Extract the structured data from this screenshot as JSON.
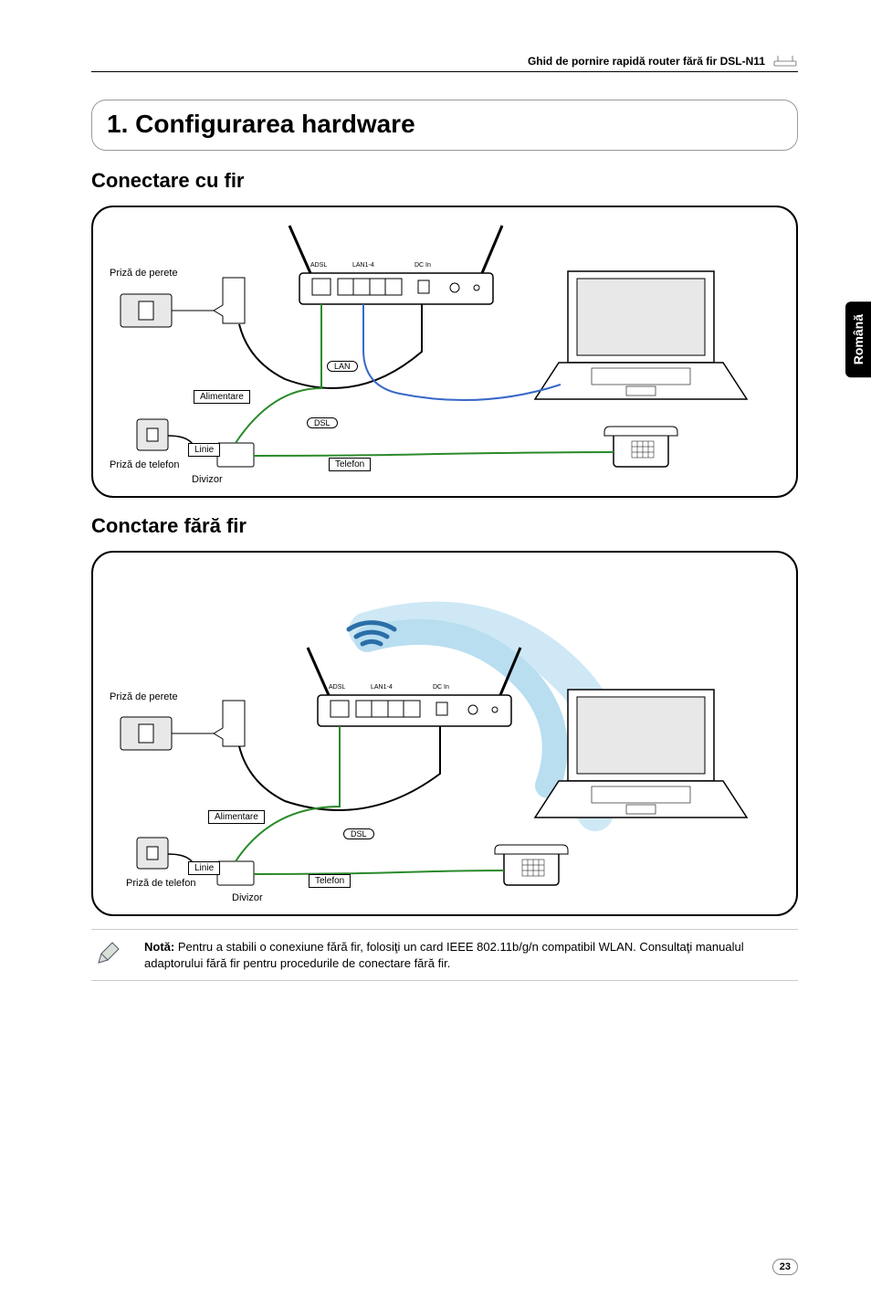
{
  "header": {
    "title": "Ghid de pornire rapidă router fără fir DSL-N11"
  },
  "language_tab": "Română",
  "section1": {
    "title": "1. Configurarea hardware",
    "wired_title": "Conectare cu fir",
    "wireless_title": "Conctare fără fir"
  },
  "diagram": {
    "wall_outlet": "Priză de perete",
    "phone_outlet": "Priză de telefon",
    "power": "Alimentare",
    "line": "Linie",
    "splitter": "Divizor",
    "telephone": "Telefon",
    "lan": "LAN",
    "dsl": "DSL",
    "ports": {
      "adsl": "ADSL",
      "lan": "LAN1-4",
      "dc": "DC In"
    }
  },
  "note": {
    "label": "Notă:",
    "text": "Pentru a stabili o conexiune fără fir, folosiţi un card IEEE 802.11b/g/n compatibil WLAN. Consultaţi manualul adaptorului fără fir pentru procedurile de conectare fără fir."
  },
  "page_number": "23"
}
